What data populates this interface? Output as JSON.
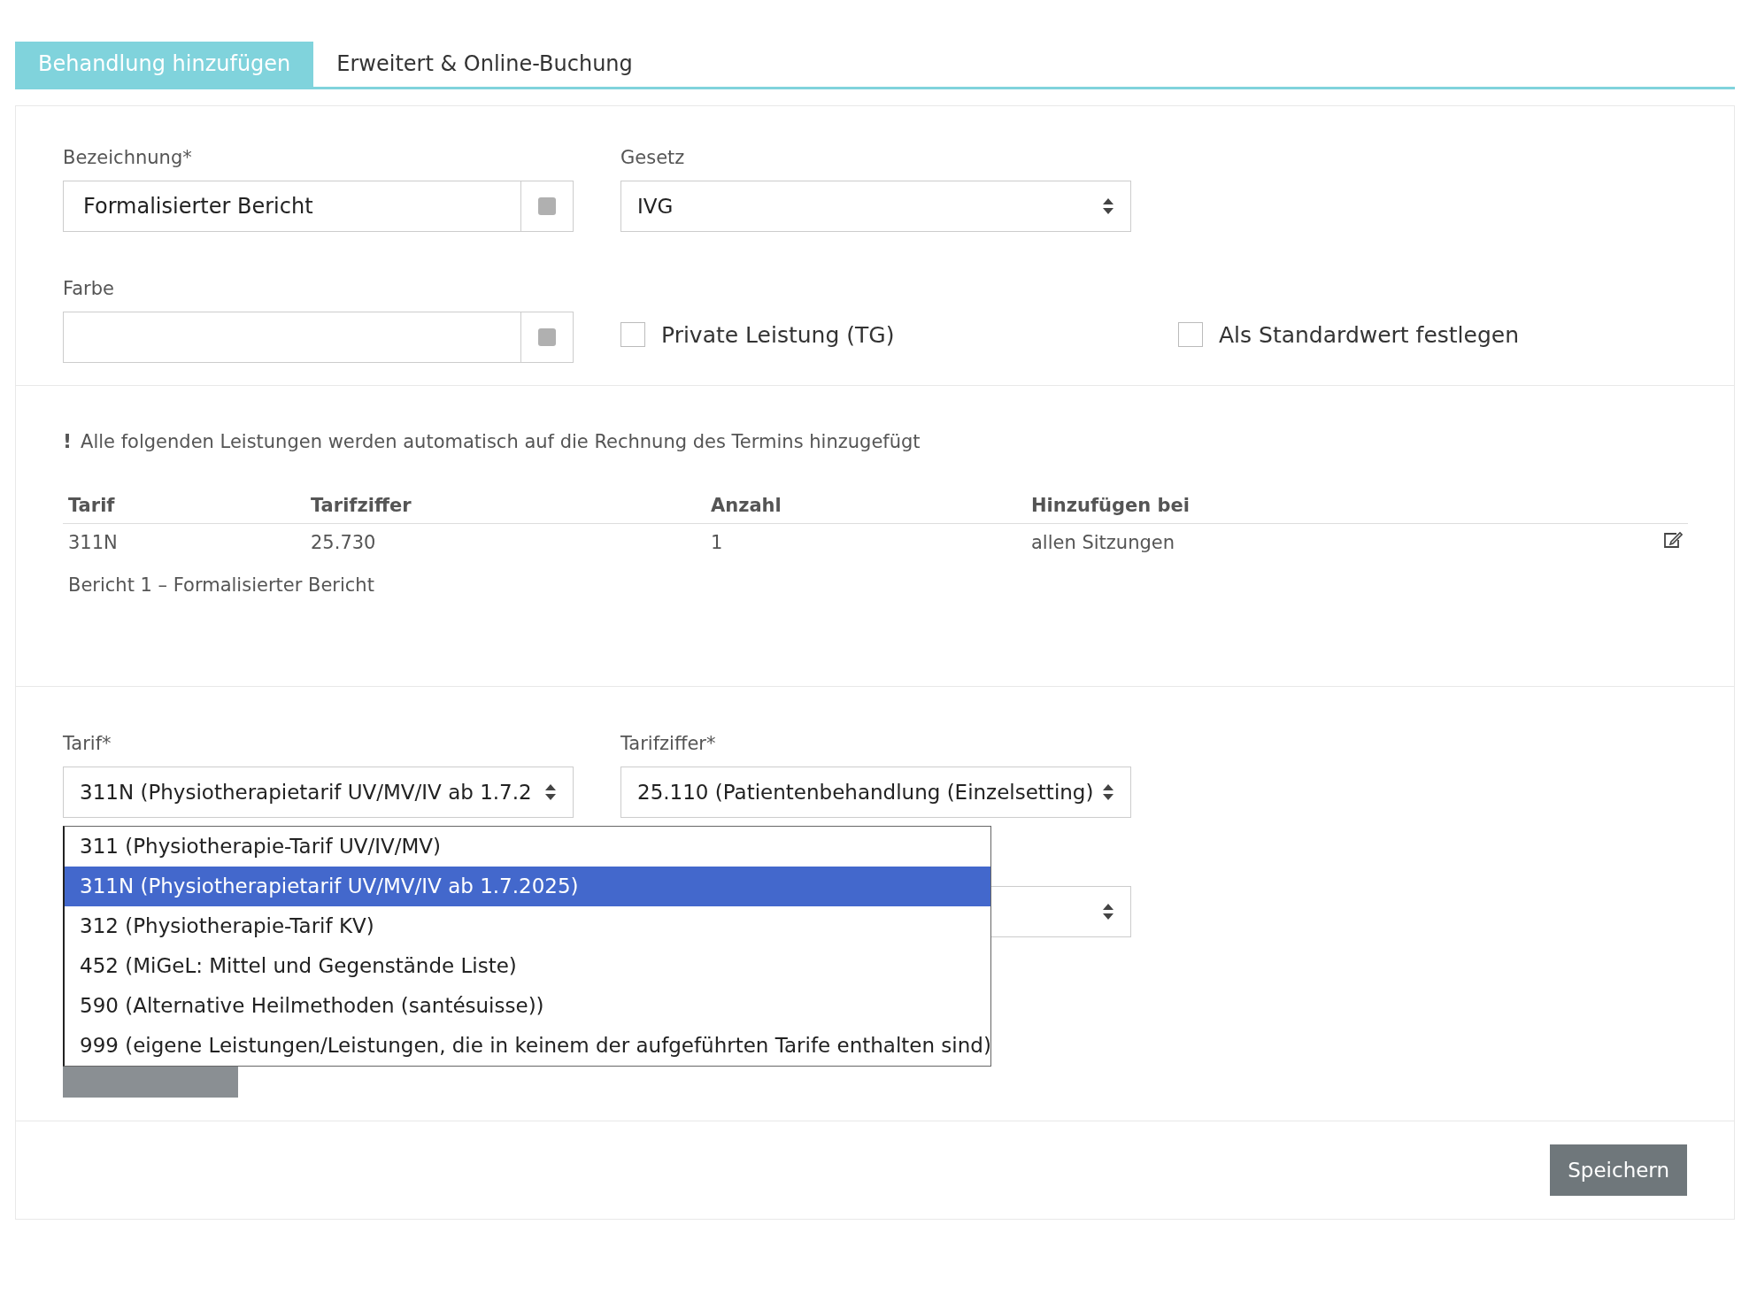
{
  "tabs": [
    {
      "label": "Behandlung hinzufügen",
      "selected": true
    },
    {
      "label": "Erweitert & Online-Buchung",
      "selected": false
    }
  ],
  "general": {
    "name_field": {
      "label": "Bezeichnung*",
      "value": "Formalisierter Bericht"
    },
    "law_field": {
      "label": "Gesetz",
      "value": "IVG"
    },
    "color_field": {
      "label": "Farbe"
    },
    "checkboxes": [
      {
        "label": "Private Leistung (TG)",
        "checked": false
      },
      {
        "label": "Als Standardwert festlegen",
        "checked": false
      }
    ]
  },
  "services": {
    "notice_mark": "!",
    "notice": "Alle folgenden Leistungen werden automatisch auf die Rechnung des Termins hinzugefügt",
    "columns": [
      "Tarif",
      "Tarifziffer",
      "Anzahl",
      "Hinzufügen bei"
    ],
    "rows": [
      {
        "cells": [
          "311N",
          "25.730",
          "1",
          "allen Sitzungen"
        ],
        "description": "Bericht 1 – Formalisierter Bericht"
      }
    ]
  },
  "add_service": {
    "tariff": {
      "label": "Tarif*",
      "value": "311N (Physiotherapietarif UV/MV/IV ab 1.7.2",
      "options": [
        {
          "label": "311 (Physiotherapie-Tarif UV/IV/MV)",
          "selected": false
        },
        {
          "label": "311N (Physiotherapietarif UV/MV/IV ab 1.7.2025)",
          "selected": true
        },
        {
          "label": "312 (Physiotherapie-Tarif KV)",
          "selected": false
        },
        {
          "label": "452 (MiGeL: Mittel und Gegenstände Liste)",
          "selected": false
        },
        {
          "label": "590 (Alternative Heilmethoden (santésuisse))",
          "selected": false
        },
        {
          "label": "999 (eigene Leistungen/Leistungen, die in keinem der aufgeführten Tarife enthalten sind)",
          "selected": false
        }
      ]
    },
    "code": {
      "label": "Tarifziffer*",
      "value": "25.110 (Patientenbehandlung (Einzelsetting)"
    }
  },
  "save_button": "Speichern"
}
